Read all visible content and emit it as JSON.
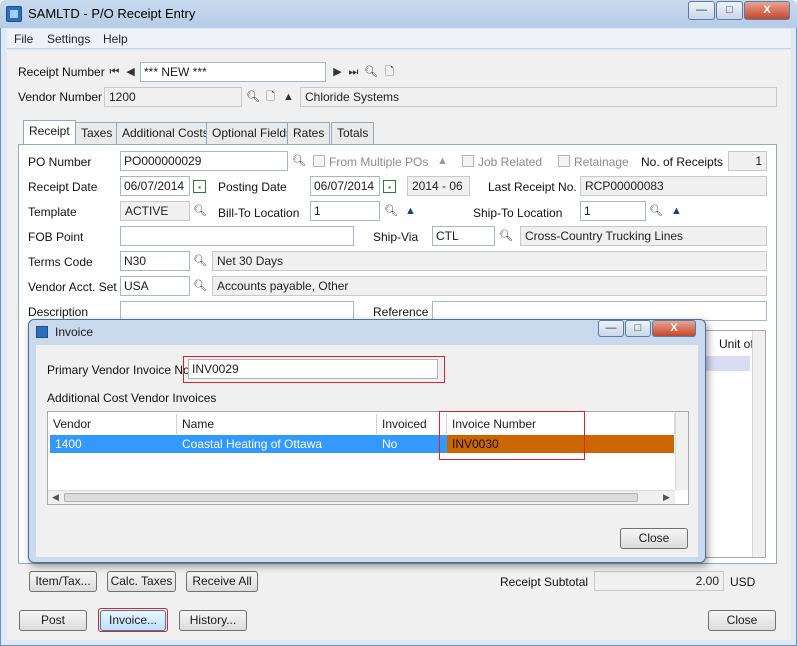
{
  "window": {
    "title": "SAMLTD - P/O Receipt Entry",
    "min": "—",
    "max": "□",
    "close": "X"
  },
  "menu": [
    "File",
    "Settings",
    "Help"
  ],
  "header": {
    "receipt_number_label": "Receipt Number",
    "receipt_number_value": "*** NEW ***",
    "vendor_number_label": "Vendor Number",
    "vendor_number_value": "1200",
    "vendor_name": "Chloride Systems"
  },
  "tabs": [
    "Receipt",
    "Taxes",
    "Additional Costs",
    "Optional Fields",
    "Rates",
    "Totals"
  ],
  "receipt": {
    "po_number_label": "PO Number",
    "po_number": "PO000000029",
    "from_multiple_pos": "From Multiple POs",
    "job_related": "Job Related",
    "retainage": "Retainage",
    "no_of_receipts_label": "No. of Receipts",
    "no_of_receipts": "1",
    "receipt_date_label": "Receipt Date",
    "receipt_date": "06/07/2014",
    "posting_date_label": "Posting Date",
    "posting_date": "06/07/2014",
    "period": "2014 - 06",
    "last_receipt_label": "Last Receipt No.",
    "last_receipt": "RCP00000083",
    "template_label": "Template",
    "template": "ACTIVE",
    "bill_to_label": "Bill-To Location",
    "bill_to": "1",
    "ship_to_label": "Ship-To Location",
    "ship_to": "1",
    "fob_label": "FOB Point",
    "fob": "",
    "ship_via_label": "Ship-Via",
    "ship_via": "CTL",
    "ship_via_desc": "Cross-Country Trucking Lines",
    "terms_label": "Terms Code",
    "terms": "N30",
    "terms_desc": "Net 30 Days",
    "vendor_acct_label": "Vendor Acct. Set",
    "vendor_acct": "USA",
    "vendor_acct_desc": "Accounts payable, Other",
    "description_label": "Description",
    "reference_label": "Reference",
    "grid_col_unit": "Unit of"
  },
  "bottom": {
    "item_tax": "Item/Tax...",
    "calc_taxes": "Calc. Taxes",
    "receive_all": "Receive All",
    "subtotal_label": "Receipt Subtotal",
    "subtotal": "2.00",
    "currency": "USD",
    "post": "Post",
    "invoice": "Invoice...",
    "history": "History...",
    "close": "Close"
  },
  "dialog": {
    "title": "Invoice",
    "primary_label": "Primary Vendor Invoice No.",
    "primary_value": "INV0029",
    "additional_label": "Additional Cost Vendor Invoices",
    "columns": [
      "Vendor",
      "Name",
      "Invoiced",
      "Invoice Number"
    ],
    "row": {
      "vendor": "1400",
      "name": "Coastal Heating of Ottawa",
      "invoiced": "No",
      "invoice_number": "INV0030"
    },
    "close": "Close"
  },
  "colors": {
    "selection": "#3399ff",
    "highlight_cell": "#cc6600",
    "callout": "#e0202a"
  }
}
